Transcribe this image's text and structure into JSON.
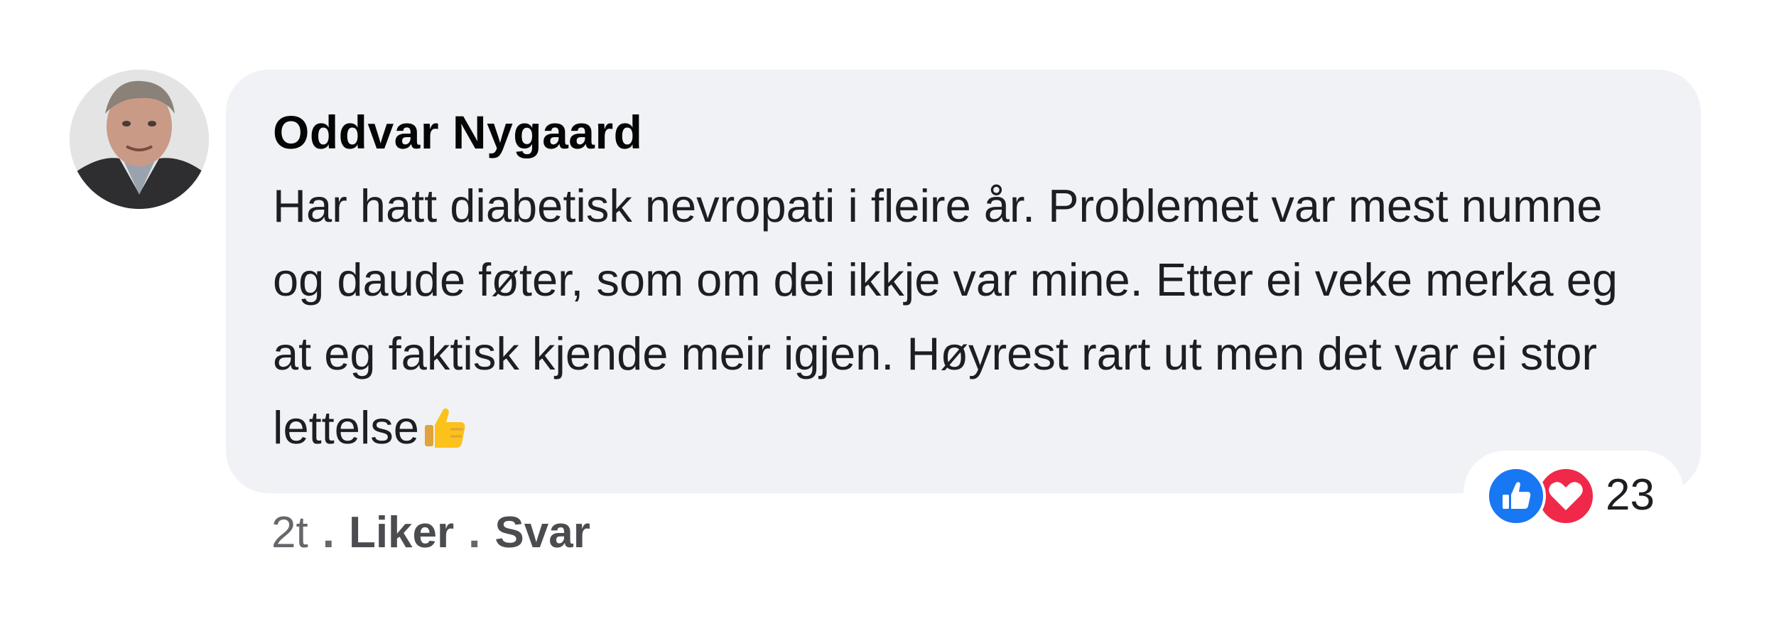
{
  "comment": {
    "author": "Oddvar Nygaard",
    "text": "Har hatt diabetisk nevropati i fleire år. Problemet var mest numne og daude føter, som om dei ikkje var mine. Etter ei veke merka eg at eg faktisk kjende meir igjen. Høyrest rart ut men det var ei stor lettelse",
    "emoji": "thumbs-up-emoji",
    "reactions": {
      "icons": [
        "like-icon",
        "love-icon"
      ],
      "count": "23"
    },
    "actions": {
      "time": "2t",
      "separator": ".",
      "like_label": "Liker",
      "reply_label": "Svar"
    }
  },
  "colors": {
    "bubble": "#f0f2f5",
    "like": "#1877f2",
    "love": "#f0284a",
    "meta": "#65676b"
  }
}
